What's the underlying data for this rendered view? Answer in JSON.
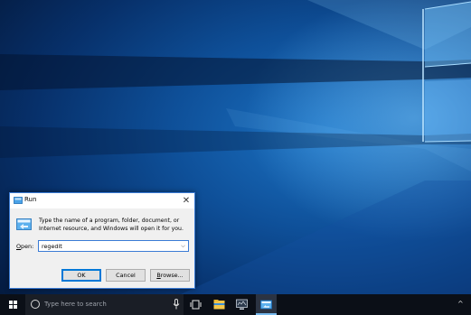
{
  "run_dialog": {
    "title": "Run",
    "close_glyph": "✕",
    "description": "Type the name of a program, folder, document, or Internet resource, and Windows will open it for you.",
    "open_label_underlined": "O",
    "open_label_rest": "pen:",
    "open_value": "regedit",
    "dropdown_glyph": "⌵",
    "ok_label": "OK",
    "cancel_label": "Cancel",
    "browse_label_underlined": "B",
    "browse_label_rest": "rowse...",
    "icon": "run-icon"
  },
  "taskbar": {
    "start_icon": "windows-logo-icon",
    "search_placeholder": "Type here to search",
    "search_icon": "cortana-circle-icon",
    "mic_icon": "microphone-icon",
    "task_view_icon": "task-view-icon",
    "apps": [
      {
        "name": "file-explorer-icon"
      },
      {
        "name": "monitor-app-icon"
      },
      {
        "name": "run-app-icon",
        "active": true
      }
    ],
    "tray_chevron": "^"
  },
  "colors": {
    "accent": "#0078d7",
    "taskbar": "#0b0f17",
    "dialog_bg": "#f0f0f0",
    "wallpaper_blue": "#0e4f98"
  }
}
